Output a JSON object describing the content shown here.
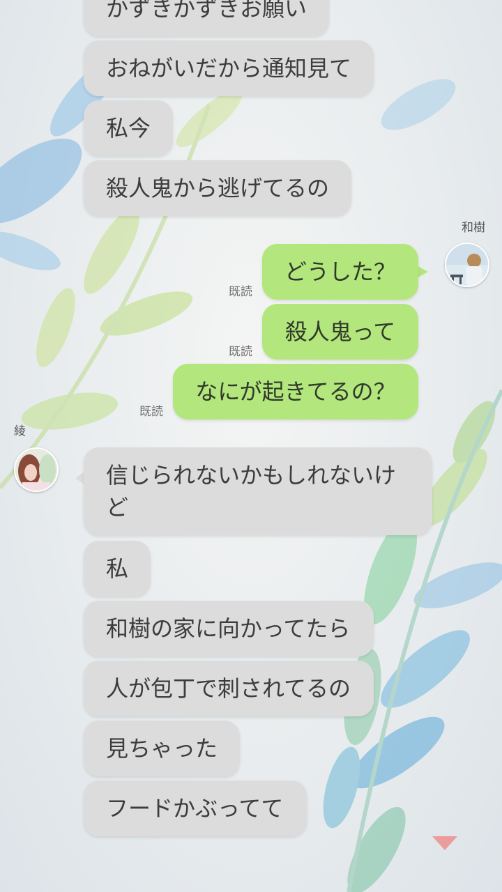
{
  "colors": {
    "incoming_bubble": "#dcdcdc",
    "outgoing_bubble": "#b3e67c",
    "read_text": "#707070"
  },
  "partner": {
    "name": "和樹"
  },
  "self": {
    "name": "綾"
  },
  "messages_top": [
    {
      "text": "かずきかずきお願い"
    },
    {
      "text": "おねがいだから通知見て"
    },
    {
      "text": "私今"
    },
    {
      "text": "殺人鬼から逃げてるの"
    }
  ],
  "messages_mine": [
    {
      "text": "どうした？",
      "status": "既読"
    },
    {
      "text": "殺人鬼って",
      "status": "既読"
    },
    {
      "text": "なにが起きてるの？",
      "status": "既読"
    }
  ],
  "messages_bottom": [
    {
      "text": "信じられないかもしれないけど"
    },
    {
      "text": "私"
    },
    {
      "text": "和樹の家に向かってたら"
    },
    {
      "text": "人が包丁で刺されてるの"
    },
    {
      "text": "見ちゃった"
    },
    {
      "text": "フードかぶってて"
    }
  ],
  "icons": {
    "scroll_down": "triangle-down-icon"
  }
}
